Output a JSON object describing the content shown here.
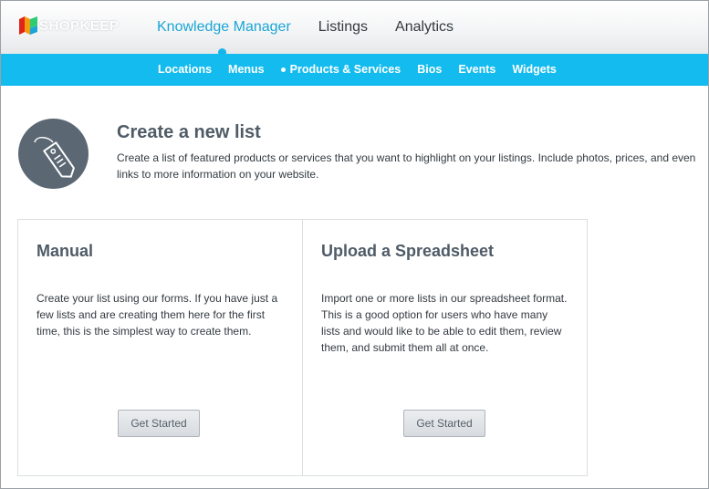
{
  "brand": {
    "name": "SHOPKEEP",
    "colors": [
      "#e2231a",
      "#f39c12",
      "#2ecc71",
      "#1aa6d6"
    ]
  },
  "main_nav": {
    "items": [
      {
        "label": "Knowledge Manager",
        "active": true
      },
      {
        "label": "Listings",
        "active": false
      },
      {
        "label": "Analytics",
        "active": false
      }
    ]
  },
  "sub_nav": {
    "items": [
      {
        "label": "Locations",
        "active": false
      },
      {
        "label": "Menus",
        "active": false
      },
      {
        "label": "Products & Services",
        "active": true
      },
      {
        "label": "Bios",
        "active": false
      },
      {
        "label": "Events",
        "active": false
      },
      {
        "label": "Widgets",
        "active": false
      }
    ]
  },
  "intro": {
    "icon": "price-tag-icon",
    "title": "Create a new list",
    "description": "Create a list of featured products or services that you want to highlight on your listings. Include photos, prices, and even links to more information on your website."
  },
  "options": [
    {
      "title": "Manual",
      "description": "Create your list using our forms. If you have just a few lists and are creating them here for the first time, this is the simplest way to create them.",
      "button": "Get Started"
    },
    {
      "title": "Upload a Spreadsheet",
      "description": "Import one or more lists in our spreadsheet format. This is a good option for users who have many lists and would like to be able to edit them, review them, and submit them all at once.",
      "button": "Get Started"
    }
  ],
  "colors": {
    "accent": "#14bbee",
    "active_text": "#1aa6d6",
    "icon_bg": "#5b6874"
  }
}
